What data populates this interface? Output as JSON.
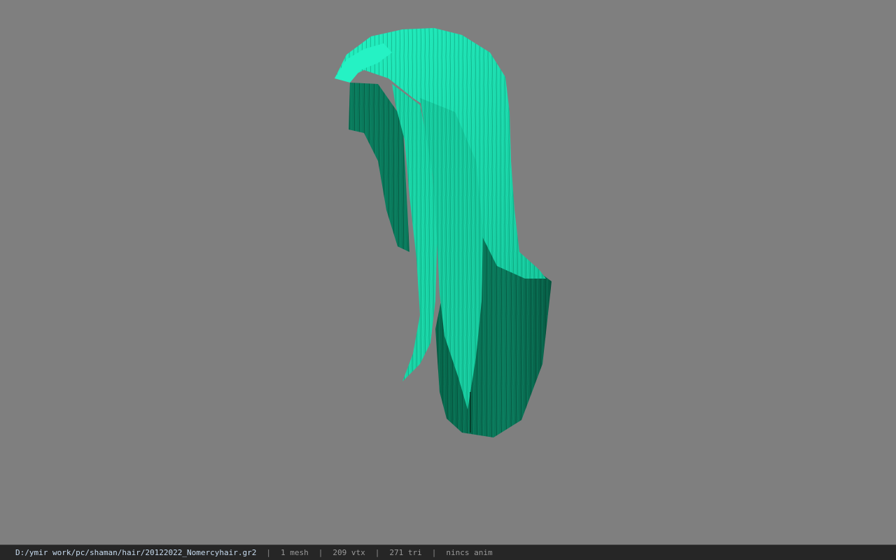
{
  "viewer": {
    "background_color": "#7f7f7f",
    "model_name": "hair mesh",
    "model_colors": {
      "light": "#1fe4b4",
      "mid": "#12b98f",
      "dark": "#0a7a5c",
      "shadow": "#06563f"
    }
  },
  "status": {
    "path": "D:/ymir work/pc/shaman/hair/20122022_Nomercyhair.gr2",
    "separator": "|",
    "mesh": "1 mesh",
    "vtx": "209 vtx",
    "tri": "271 tri",
    "anim": "nincs anim"
  }
}
